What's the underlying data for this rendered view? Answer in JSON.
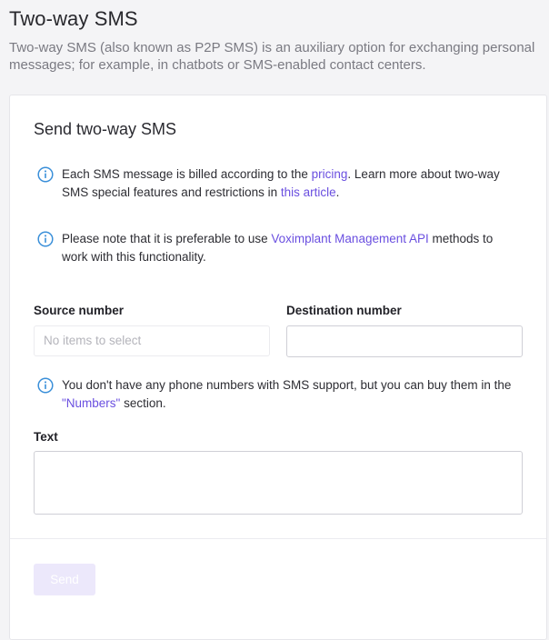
{
  "page": {
    "title": "Two-way SMS",
    "description": "Two-way SMS (also known as P2P SMS) is an auxiliary option for exchanging personal messages; for example, in chatbots or SMS-enabled contact centers."
  },
  "card": {
    "title": "Send two-way SMS",
    "note_billing": {
      "text_1": "Each SMS message is billed according to the ",
      "link_pricing": "pricing",
      "text_2": ". Learn more about two-way SMS special features and restrictions in ",
      "link_article": "this article",
      "text_3": "."
    },
    "note_api": {
      "text_1": "Please note that it is preferable to use ",
      "link_api": "Voximplant Management API",
      "text_2": " methods to work with this functionality."
    },
    "source_number": {
      "label": "Source number",
      "placeholder": "No items to select"
    },
    "destination_number": {
      "label": "Destination number",
      "value": ""
    },
    "note_numbers": {
      "text_1": "You don't have any phone numbers with SMS support, but you can buy them in the ",
      "link_numbers": "\"Numbers\"",
      "text_2": " section."
    },
    "text_field": {
      "label": "Text",
      "value": ""
    },
    "send_label": "Send"
  },
  "colors": {
    "accent": "#6a4fe0",
    "info_icon": "#3a8fd9",
    "send_disabled_bg": "#ece8fb"
  },
  "icons": {
    "info": "info-circle-icon"
  }
}
